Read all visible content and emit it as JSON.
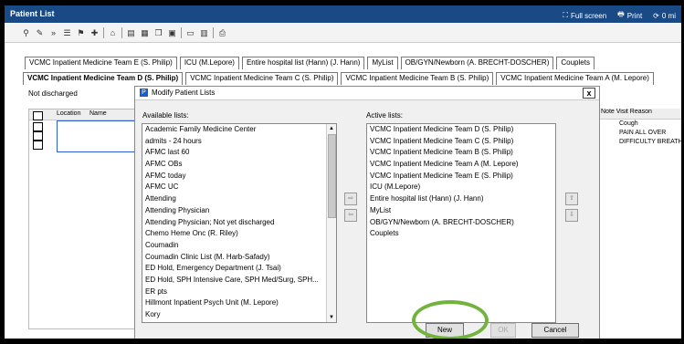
{
  "window": {
    "title": "Patient List",
    "fullscreen_label": "Full screen",
    "print_label": "Print",
    "refresh_label": "0 mi"
  },
  "tabs_row1": [
    "VCMC Inpatient Medicine Team E  (S. Philip)",
    "ICU (M.Lepore)",
    "Entire hospital list (Hann)  (J. Hann)",
    "MyList",
    "OB/GYN/Newborn  (A. BRECHT-DOSCHER)",
    "Couplets"
  ],
  "tabs_row2": [
    "VCMC Inpatient Medicine Team D  (S. Philip)",
    "VCMC Inpatient Medicine Team C  (S. Philip)",
    "VCMC Inpatient Medicine Team B  (S. Philip)",
    "VCMC Inpatient Medicine Team A  (M. Lepore)"
  ],
  "filter_label": "Not discharged",
  "left_pane": {
    "col_location": "Location",
    "col_name": "Name"
  },
  "right_pane": {
    "header": "Note Visit Reason",
    "rows": [
      "Cough",
      "PAIN ALL OVER",
      "DIFFICULTY BREATHING"
    ]
  },
  "dialog": {
    "title": "Modify Patient Lists",
    "close_label": "x",
    "available_label": "Available lists:",
    "active_label": "Active lists:",
    "available_items": [
      "Academic Family Medicine Center",
      "admits - 24 hours",
      "AFMC last 60",
      "AFMC OBs",
      "AFMC today",
      "AFMC UC",
      "Attending",
      "Attending Physician",
      "Attending Physician; Not yet discharged",
      "Chemo Heme Onc  (R. Riley)",
      "Coumadin",
      "Coumadin Clinic List  (M. Harb-Safady)",
      "ED Hold, Emergency Department  (J. Tsai)",
      "ED Hold, SPH Intensive Care, SPH Med/Surg, SPH...",
      "ER pts",
      "Hillmont Inpatient Psych Unit  (M. Lepore)",
      "Kory"
    ],
    "active_items": [
      "VCMC Inpatient Medicine Team D  (S. Philip)",
      "VCMC Inpatient Medicine Team C  (S. Philip)",
      "VCMC Inpatient Medicine Team B  (S. Philip)",
      "VCMC Inpatient Medicine Team A  (M. Lepore)",
      "VCMC Inpatient Medicine Team E  (S. Philip)",
      "ICU (M.Lepore)",
      "Entire hospital list (Hann)  (J. Hann)",
      "MyList",
      "OB/GYN/Newborn  (A. BRECHT-DOSCHER)",
      "Couplets"
    ],
    "new_label": "New",
    "ok_label": "OK",
    "cancel_label": "Cancel"
  },
  "colors": {
    "titlebar": "#1a4a86",
    "highlight_ring": "#72b33d"
  }
}
